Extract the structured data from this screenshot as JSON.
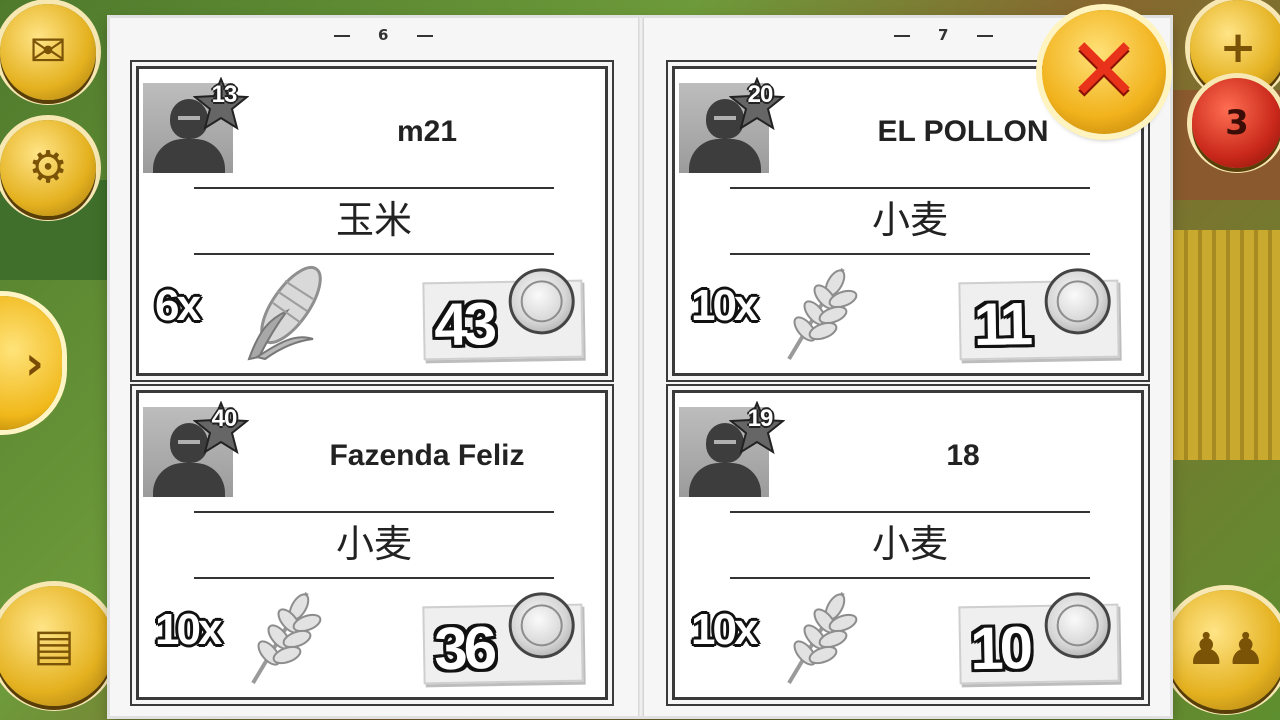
{
  "pages": {
    "left": "6",
    "right": "7"
  },
  "hud": {
    "mail_icon": "envelope-icon",
    "settings_icon": "gear-icon",
    "expand_icon": "chevron-right-icon",
    "shop_icon": "cash-register-icon",
    "add_icon": "plus-icon",
    "friends_icon": "friends-icon",
    "notification_count": "3"
  },
  "close": {
    "icon": "close-x-icon"
  },
  "listings": [
    {
      "level": "13",
      "player": "m21",
      "item": "玉米",
      "quantity": "6x",
      "item_icon": "corn-icon",
      "price": "43"
    },
    {
      "level": "20",
      "player": "EL POLLON",
      "item": "小麦",
      "quantity": "10x",
      "item_icon": "wheat-icon",
      "price": "11"
    },
    {
      "level": "40",
      "player": "Fazenda Feliz",
      "item": "小麦",
      "quantity": "10x",
      "item_icon": "wheat-icon",
      "price": "36"
    },
    {
      "level": "19",
      "player": "18",
      "item": "小麦",
      "quantity": "10x",
      "item_icon": "wheat-icon",
      "price": "10"
    }
  ]
}
